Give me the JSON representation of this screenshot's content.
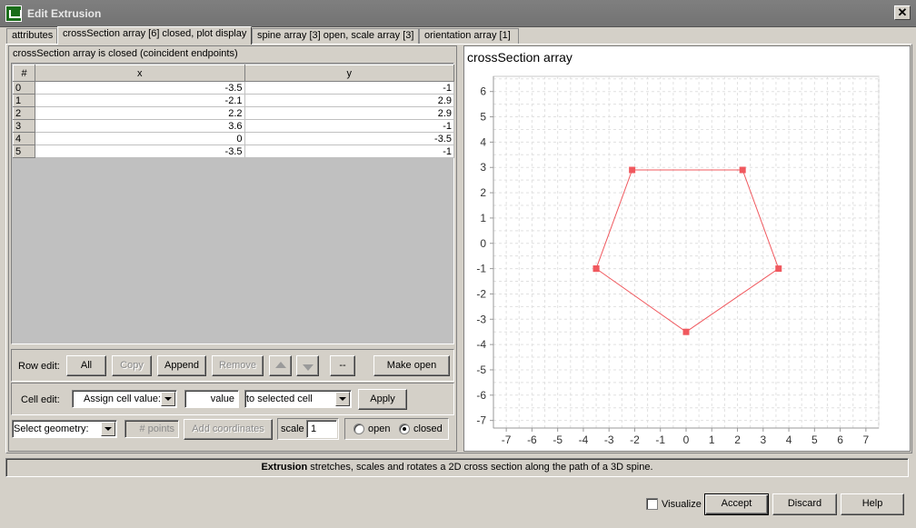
{
  "window": {
    "title": "Edit Extrusion",
    "close_glyph": "✕"
  },
  "tabs": [
    {
      "label": "attributes",
      "active": false
    },
    {
      "label": "crossSection array [6] closed, plot display",
      "active": true
    },
    {
      "label": "spine array [3] open, scale array [3]",
      "active": false
    },
    {
      "label": "orientation array [1]",
      "active": false
    }
  ],
  "table": {
    "caption": "crossSection array is closed (coincident endpoints)",
    "columns": [
      "#",
      "x",
      "y"
    ],
    "rows": [
      {
        "index": "0",
        "x": "-3.5",
        "y": "-1"
      },
      {
        "index": "1",
        "x": "-2.1",
        "y": "2.9"
      },
      {
        "index": "2",
        "x": "2.2",
        "y": "2.9"
      },
      {
        "index": "3",
        "x": "3.6",
        "y": "-1"
      },
      {
        "index": "4",
        "x": "0",
        "y": "-3.5"
      },
      {
        "index": "5",
        "x": "-3.5",
        "y": "-1"
      }
    ]
  },
  "row_edit": {
    "label": "Row edit:",
    "all": "All",
    "copy": "Copy",
    "append": "Append",
    "remove": "Remove",
    "dash": "--",
    "make_open": "Make open"
  },
  "cell_edit": {
    "label": "Cell edit:",
    "mode": "Assign cell value:",
    "value": "value",
    "target": "to selected cell",
    "apply": "Apply"
  },
  "geometry": {
    "select": "Select geometry:",
    "points_placeholder": "# points",
    "add_coordinates": "Add coordinates",
    "scale_label": "scale",
    "scale_value": "1",
    "open_label": "open",
    "closed_label": "closed",
    "closed_selected": true
  },
  "status": {
    "bold": "Extrusion",
    "text": " stretches, scales and rotates a 2D cross section along the path of a 3D spine."
  },
  "footer": {
    "visualize": "Visualize",
    "accept": "Accept",
    "discard": "Discard",
    "help": "Help"
  },
  "colors": {
    "series": "#f0585e",
    "grid": "#e0e0e0",
    "title_bar": "#7a7a7a"
  },
  "chart_data": {
    "type": "line",
    "title": "crossSection array",
    "xlabel": "",
    "ylabel": "",
    "xlim": [
      -7.5,
      7.5
    ],
    "ylim": [
      -7.3,
      6.6
    ],
    "xticks": [
      -7,
      -6,
      -5,
      -4,
      -3,
      -2,
      -1,
      0,
      1,
      2,
      3,
      4,
      5,
      6,
      7
    ],
    "yticks": [
      6,
      5,
      4,
      3,
      2,
      1,
      0,
      -1,
      -2,
      -3,
      -4,
      -5,
      -6,
      -7
    ],
    "grid": true,
    "series": [
      {
        "points": [
          [
            -3.5,
            -1
          ],
          [
            -2.1,
            2.9
          ],
          [
            2.2,
            2.9
          ],
          [
            3.6,
            -1
          ],
          [
            0,
            -3.5
          ],
          [
            -3.5,
            -1
          ]
        ]
      }
    ]
  }
}
